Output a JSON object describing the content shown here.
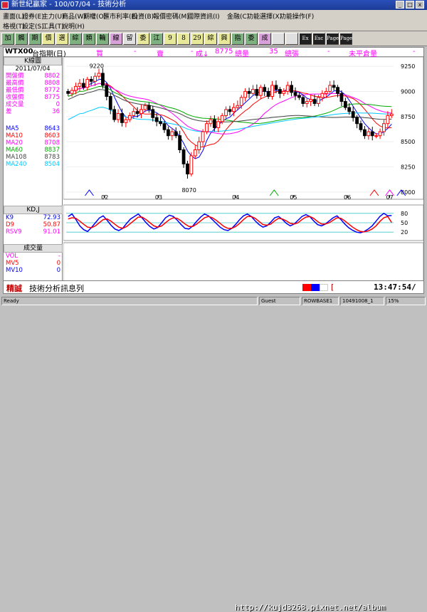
{
  "window": {
    "title": "新世紀贏家 - 100/07/04 - 技術分析",
    "min": "_",
    "max": "□",
    "close": "x"
  },
  "menu": {
    "row1": [
      "畫面(L)",
      "證券(E)",
      "主力(U)",
      "商品(W)",
      "期權(O)",
      "匯市利率(E)",
      "投資(B)",
      "報價密碼(M)",
      "國際資訊(I)",
      "金融(C)",
      "功能選擇(X)",
      "功能操作(F)"
    ],
    "row2": [
      "格視(T)",
      "設定(S)",
      "工具(T)",
      "說明(H)"
    ]
  },
  "toolbar": [
    "加",
    "觸",
    "期",
    "價",
    "選",
    "綜",
    "類",
    "輪",
    "線",
    "留",
    "委",
    "江",
    "9",
    "8",
    "29",
    "綜",
    "興",
    "指",
    "委",
    "成",
    "",
    ""
  ],
  "toolbar_extra": [
    "Ex",
    "Esc",
    "Page",
    "Page"
  ],
  "header": {
    "symbol": "WTX00",
    "name": "台指期(日)",
    "buy_label": "買",
    "sell_label": "賣",
    "trade_label": "成↓",
    "trade_value": "8775",
    "change_label": "總量",
    "change_value": "35",
    "vol_label": "總張",
    "open_label": "未平倉量",
    "dash": "-"
  },
  "kline": {
    "title": "K線圖",
    "date": "2011/07/04",
    "fields": [
      {
        "label": "開盤價",
        "value": "8802"
      },
      {
        "label": "最高價",
        "value": "8808"
      },
      {
        "label": "最低價",
        "value": "8772"
      },
      {
        "label": "收盤價",
        "value": "8775"
      },
      {
        "label": "成交量",
        "value": "0"
      },
      {
        "label": "差",
        "value": "36"
      }
    ],
    "ma": [
      {
        "label": "MA5",
        "value": "8643",
        "color": "#0000ff"
      },
      {
        "label": "MA10",
        "value": "8603",
        "color": "#ff0000"
      },
      {
        "label": "MA20",
        "value": "8708",
        "color": "#ff00ff"
      },
      {
        "label": "MA60",
        "value": "8837",
        "color": "#00aa00"
      },
      {
        "label": "MA108",
        "value": "8783",
        "color": "#444444"
      },
      {
        "label": "MA240",
        "value": "8504",
        "color": "#00c8ff"
      }
    ]
  },
  "kd": {
    "title": "KD,J",
    "fields": [
      {
        "label": "K9",
        "value": "72.93",
        "color": "#0000ff"
      },
      {
        "label": "D9",
        "value": "50.87",
        "color": "#ff0000"
      },
      {
        "label": "RSV9",
        "value": "91.01",
        "color": "#ff00ff"
      }
    ]
  },
  "volume": {
    "title": "成交量",
    "fields": [
      {
        "label": "VOL",
        "value": "-",
        "color": "#ff00ff"
      },
      {
        "label": "MV5",
        "value": "0",
        "color": "#ff0000"
      },
      {
        "label": "MV10",
        "value": "0",
        "color": "#0000ff"
      }
    ]
  },
  "axes": {
    "price_ticks": [
      "9250",
      "9000",
      "8750",
      "8500",
      "8250",
      "8000"
    ],
    "kd_ticks": [
      "80",
      "50",
      "20"
    ],
    "months": [
      "02",
      "03",
      "04",
      "05",
      "06",
      "07"
    ],
    "high_label": "9220",
    "low_label": "8070"
  },
  "status": {
    "tag": "精誠",
    "message": "技術分析訊息列",
    "bracket": "[",
    "time": "13:47:54/"
  },
  "bottom": {
    "ready": "Ready",
    "guest": "Guest",
    "row": "ROWBASE1",
    "code": "10491008_1",
    "pct": "15%",
    "watermark": "http://kujd3268.pixnet.net/album"
  },
  "chart_data": [
    {
      "type": "candlestick",
      "title": "K線圖",
      "x": [
        "02",
        "03",
        "04",
        "05",
        "06",
        "07"
      ],
      "ylim": [
        7950,
        9300
      ],
      "y_ticks": [
        9250,
        9000,
        8750,
        8500,
        8250,
        8000
      ],
      "marked_high": 9220,
      "marked_low": 8070,
      "close": [
        8980,
        9010,
        9050,
        9080,
        9040,
        9120,
        9100,
        9150,
        9180,
        9060,
        8950,
        8820,
        8720,
        8780,
        8690,
        8720,
        8760,
        8800,
        8780,
        8820,
        8860,
        8820,
        8740,
        8700,
        8680,
        8620,
        8560,
        8600,
        8560,
        8420,
        8280,
        8180,
        8360,
        8420,
        8500,
        8600,
        8680,
        8720,
        8640,
        8700,
        8760,
        8820,
        8800,
        8840,
        8860,
        8940,
        9000,
        8980,
        9020,
        8960,
        9040,
        9000,
        8950,
        9060,
        9020,
        8980,
        9000,
        9060,
        8990,
        8960,
        8940,
        8880,
        8900,
        8920,
        8880,
        8940,
        8980,
        9000,
        9060,
        9040,
        8980,
        8900,
        8840,
        8800,
        8740,
        8680,
        8620,
        8560,
        8600,
        8560,
        8560,
        8600,
        8680,
        8760,
        8775
      ],
      "ma": [
        {
          "name": "MA5",
          "color": "#0000ff"
        },
        {
          "name": "MA10",
          "color": "#ff0000"
        },
        {
          "name": "MA20",
          "color": "#ff00ff"
        },
        {
          "name": "MA60",
          "color": "#00aa00"
        },
        {
          "name": "MA108",
          "color": "#444444"
        },
        {
          "name": "MA240",
          "color": "#00c8ff"
        }
      ]
    },
    {
      "type": "line",
      "title": "KD,J",
      "ylim": [
        0,
        100
      ],
      "y_ticks": [
        80,
        50,
        20
      ],
      "series": [
        {
          "name": "K9",
          "color": "#0000ff",
          "values": [
            70,
            78,
            60,
            40,
            28,
            22,
            35,
            50,
            65,
            72,
            58,
            42,
            30,
            25,
            32,
            48,
            62,
            70,
            78,
            65,
            50,
            38,
            30,
            35,
            50,
            66,
            74,
            70,
            58,
            44,
            32,
            30,
            40,
            55,
            68,
            78,
            72,
            60,
            48,
            36,
            28,
            25,
            32,
            45,
            60,
            72,
            78,
            70,
            56,
            44,
            36,
            40,
            52,
            66,
            70,
            60,
            48,
            40,
            46,
            58,
            70,
            76,
            70,
            56,
            44,
            40,
            46,
            56,
            66,
            72,
            60,
            46,
            34,
            26,
            20,
            18,
            22,
            30,
            40,
            55,
            70,
            80,
            72,
            73
          ]
        },
        {
          "name": "D9",
          "color": "#ff0000",
          "values": [
            62,
            66,
            64,
            55,
            45,
            36,
            34,
            40,
            50,
            60,
            62,
            55,
            45,
            36,
            32,
            38,
            48,
            58,
            68,
            68,
            60,
            50,
            40,
            36,
            40,
            50,
            60,
            66,
            64,
            56,
            46,
            38,
            38,
            46,
            56,
            66,
            70,
            66,
            58,
            48,
            38,
            32,
            32,
            38,
            48,
            60,
            70,
            70,
            64,
            54,
            44,
            42,
            46,
            56,
            64,
            62,
            56,
            48,
            46,
            50,
            60,
            68,
            70,
            64,
            54,
            46,
            46,
            50,
            58,
            66,
            64,
            56,
            46,
            36,
            28,
            22,
            21,
            24,
            30,
            40,
            54,
            66,
            70,
            51
          ]
        }
      ]
    }
  ]
}
